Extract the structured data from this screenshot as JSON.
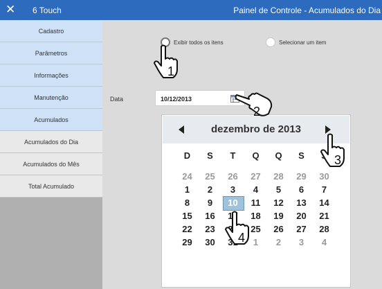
{
  "window": {
    "app_name": "6 Touch",
    "title": "Painel de Controle - Acumulados do Dia"
  },
  "sidebar": {
    "items": [
      {
        "label": "Cadastro"
      },
      {
        "label": "Parâmetros"
      },
      {
        "label": "Informações"
      },
      {
        "label": "Manutenção"
      },
      {
        "label": "Acumulados"
      },
      {
        "label": "Acumulados do Dia"
      },
      {
        "label": "Acumulados do Mês"
      },
      {
        "label": "Total Acumulado"
      }
    ]
  },
  "filters": {
    "option_all": "Exibir todos os itens",
    "option_one": "Selecionar um item",
    "selected": "option_all"
  },
  "date": {
    "label": "Data",
    "value": "10/12/2013"
  },
  "calendar": {
    "month_label": "dezembro de 2013",
    "weekdays": [
      "D",
      "S",
      "T",
      "Q",
      "Q",
      "S",
      "S"
    ],
    "weeks": [
      [
        "24",
        "25",
        "26",
        "27",
        "28",
        "29",
        "30"
      ],
      [
        "1",
        "2",
        "3",
        "4",
        "5",
        "6",
        "7"
      ],
      [
        "8",
        "9",
        "10",
        "11",
        "12",
        "13",
        "14"
      ],
      [
        "15",
        "16",
        "17",
        "18",
        "19",
        "20",
        "21"
      ],
      [
        "22",
        "23",
        "24",
        "25",
        "26",
        "27",
        "28"
      ],
      [
        "29",
        "30",
        "31",
        "1",
        "2",
        "3",
        "4"
      ]
    ],
    "selected_day": "10"
  },
  "annotations": [
    "1",
    "2",
    "3",
    "4"
  ],
  "colors": {
    "titlebar": "#2d6bbf",
    "sidebar_primary": "#cfe1f6",
    "selected_day": "#9fc2dd"
  }
}
